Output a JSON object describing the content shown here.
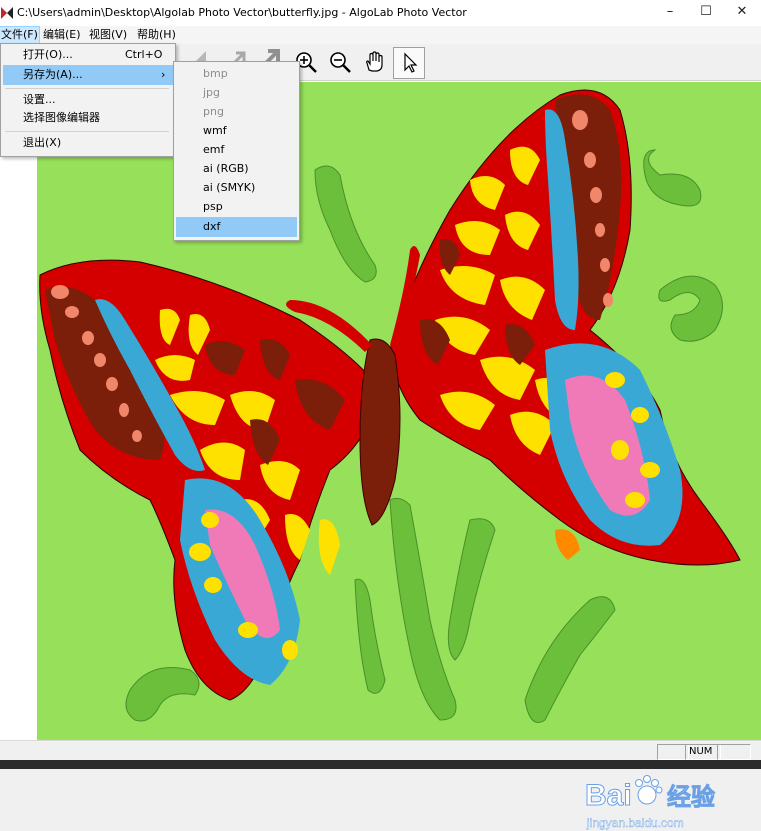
{
  "window": {
    "title": "C:\\Users\\admin\\Desktop\\Algolab Photo Vector\\butterfly.jpg - AlgoLab Photo Vector",
    "minimize": "–",
    "maximize": "☐",
    "close": "✕"
  },
  "menubar": {
    "items": [
      {
        "label": "文件(F)"
      },
      {
        "label": "编辑(E)"
      },
      {
        "label": "视图(V)"
      },
      {
        "label": "帮助(H)"
      }
    ]
  },
  "file_menu": {
    "open": {
      "label": "打开(O)...",
      "shortcut": "Ctrl+O"
    },
    "save_as": {
      "label": "另存为(A)...",
      "arrow": "›"
    },
    "settings": {
      "label": "设置..."
    },
    "choose_editor": {
      "label": "选择图像编辑器"
    },
    "exit": {
      "label": "退出(X)"
    }
  },
  "save_as_submenu": {
    "items": [
      {
        "label": "bmp",
        "enabled": false
      },
      {
        "label": "jpg",
        "enabled": false
      },
      {
        "label": "png",
        "enabled": false
      },
      {
        "label": "wmf",
        "enabled": true
      },
      {
        "label": "emf",
        "enabled": true
      },
      {
        "label": "ai (RGB)",
        "enabled": true
      },
      {
        "label": "ai (SMYK)",
        "enabled": true
      },
      {
        "label": "psp",
        "enabled": true
      },
      {
        "label": "dxf",
        "enabled": true,
        "highlighted": true
      }
    ]
  },
  "toolbar": {
    "tools": [
      "zoom-in-icon",
      "zoom-out-icon",
      "hand-icon",
      "pointer-icon"
    ],
    "active_tool": "pointer-icon"
  },
  "statusbar": {
    "num_indicator": "NUM"
  },
  "watermark": {
    "brand": "Bai",
    "brand2": "经验",
    "url": "jingyan.baidu.com"
  },
  "colors": {
    "background_green": "#96e05a",
    "wing_red": "#d40000",
    "wing_brown": "#7b1e0a",
    "wing_yellow": "#ffe100",
    "wing_blue": "#3aa8d4",
    "wing_pink": "#f07ab8",
    "wing_salmon": "#f0866a",
    "leaf_green": "#6cbf3a",
    "menu_highlight": "#91c9f7"
  }
}
